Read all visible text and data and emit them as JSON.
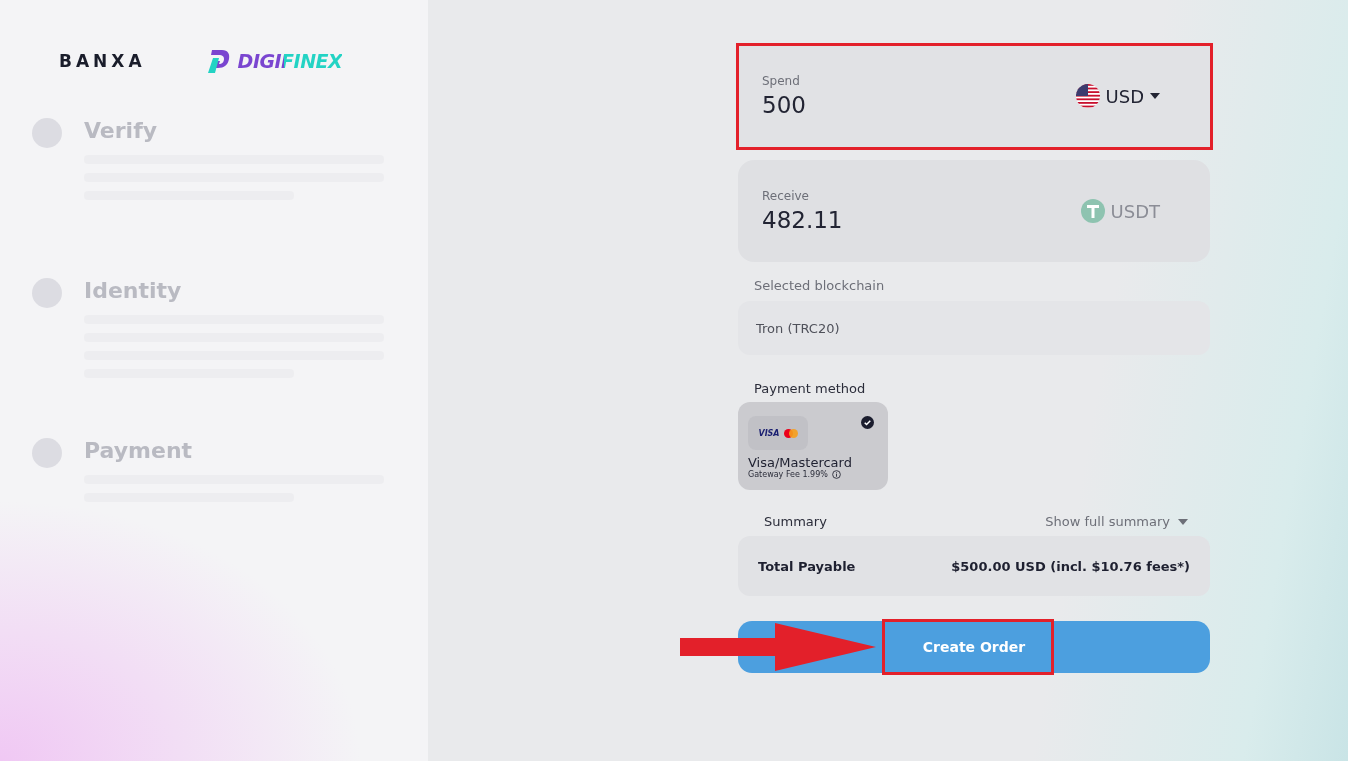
{
  "logos": {
    "banxa": "BANXA",
    "partner": "DIGIFINEX"
  },
  "steps": [
    {
      "title": "Verify"
    },
    {
      "title": "Identity"
    },
    {
      "title": "Payment"
    }
  ],
  "spend": {
    "label": "Spend",
    "value": "500",
    "currency": "USD"
  },
  "receive": {
    "label": "Receive",
    "value": "482.11",
    "currency": "USDT"
  },
  "blockchain": {
    "label": "Selected blockchain",
    "value": "Tron (TRC20)"
  },
  "payment": {
    "label": "Payment method",
    "methods": [
      {
        "logo": "VISA",
        "name": "Visa/Mastercard",
        "fee": "Gateway Fee 1.99%",
        "selected": true
      }
    ]
  },
  "summary": {
    "label": "Summary",
    "toggle": "Show full summary",
    "total_label": "Total Payable",
    "total_value": "$500.00 USD (incl. $10.76 fees*)"
  },
  "button": "Create Order"
}
